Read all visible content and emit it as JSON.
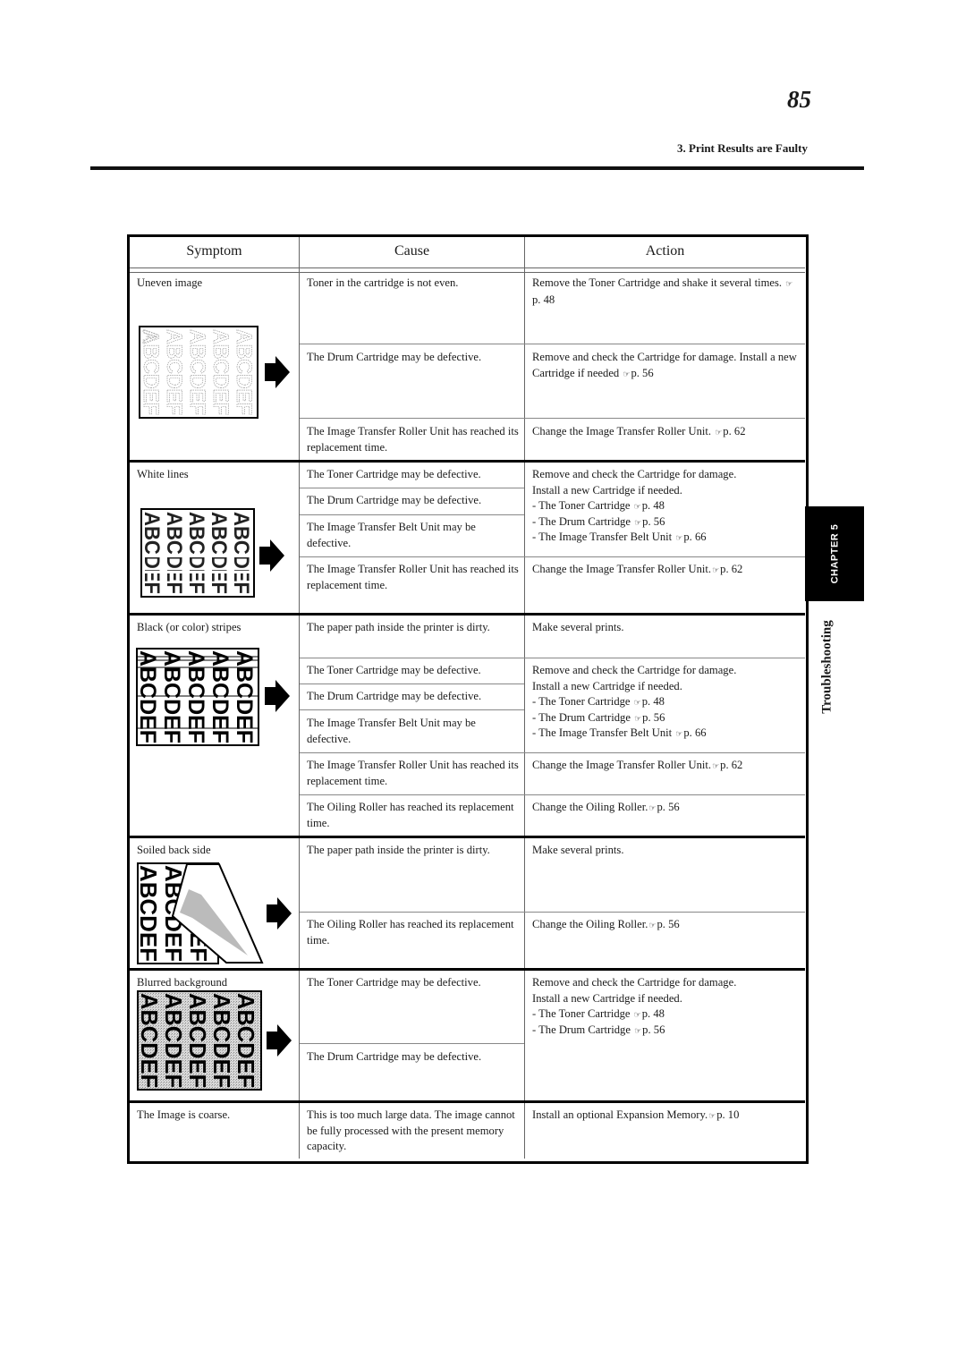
{
  "header": {
    "page_number": "85",
    "section_title": "3. Print Results are Faulty"
  },
  "side_tab": {
    "chapter_label": "CHAPTER 5",
    "chapter_title": "Troubleshooting"
  },
  "table": {
    "columns": [
      "Symptom",
      "Cause",
      "Action"
    ],
    "reference_icon": "pointing-hand-icon",
    "groups": [
      {
        "symptom": "Uneven image",
        "sample_image": "uneven-image-sample",
        "rows": [
          {
            "cause": "Toner in the cartridge is not even.",
            "action": "Remove the Toner Cartridge and shake it several times.",
            "action_ref": "p. 48"
          },
          {
            "cause": "The Drum Cartridge may be defective.",
            "action": "Remove and check the Cartridge for damage. Install a new Cartridge if needed",
            "action_ref": "p. 56"
          },
          {
            "cause": "The Image Transfer Roller Unit has reached its replacement time.",
            "action": "Change the Image Transfer Roller Unit.",
            "action_ref": "p. 62"
          }
        ]
      },
      {
        "symptom": "White lines",
        "sample_image": "white-lines-sample",
        "rows": [
          {
            "cause": "The Toner Cartridge may be defective."
          },
          {
            "cause": "The Drum Cartridge may be defective."
          },
          {
            "cause": "The Image Transfer Belt Unit may be defective."
          },
          {
            "cause": "The Image Transfer Roller Unit has reached its replacement time.",
            "action": "Change the Image Transfer Roller Unit.",
            "action_ref": "p. 62"
          }
        ],
        "shared_action": {
          "lines": [
            "Remove and check the Cartridge for damage.",
            "Install a new Cartridge if needed."
          ],
          "refs": [
            {
              "label": "- The Toner Cartridge",
              "ref": "p. 48"
            },
            {
              "label": "- The Drum Cartridge",
              "ref": "p. 56"
            },
            {
              "label": "- The Image Transfer Belt Unit",
              "ref": "p. 66"
            }
          ]
        }
      },
      {
        "symptom": "Black (or color) stripes",
        "sample_image": "black-stripes-sample",
        "rows": [
          {
            "cause": "The paper path inside the printer is dirty.",
            "action": "Make several prints."
          },
          {
            "cause": "The Toner Cartridge may be defective."
          },
          {
            "cause": "The Drum Cartridge may be defective."
          },
          {
            "cause": "The Image Transfer Belt Unit may be defective."
          },
          {
            "cause": "The Image Transfer Roller Unit has reached its replacement time.",
            "action": "Change the Image Transfer Roller Unit.",
            "action_ref": "p. 62"
          },
          {
            "cause": "The Oiling Roller has reached its replacement time.",
            "action": "Change the Oiling Roller.",
            "action_ref": "p. 56"
          }
        ],
        "shared_action": {
          "lines": [
            "Remove and check the Cartridge for damage.",
            "Install a new Cartridge if needed."
          ],
          "refs": [
            {
              "label": "- The Toner Cartridge",
              "ref": "p. 48"
            },
            {
              "label": "- The Drum Cartridge",
              "ref": "p. 56"
            },
            {
              "label": "- The Image Transfer Belt Unit",
              "ref": "p. 66"
            }
          ]
        }
      },
      {
        "symptom": "Soiled back side",
        "sample_image": "soiled-back-side-sample",
        "rows": [
          {
            "cause": "The paper path inside the printer is dirty.",
            "action": "Make several prints."
          },
          {
            "cause": "The Oiling Roller has reached its replacement time.",
            "action": "Change the Oiling Roller.",
            "action_ref": "p. 56"
          }
        ]
      },
      {
        "symptom": "Blurred background",
        "sample_image": "blurred-background-sample",
        "rows": [
          {
            "cause": "The Toner Cartridge may be defective."
          },
          {
            "cause": "The Drum Cartridge may be defective."
          }
        ],
        "shared_action": {
          "lines": [
            "Remove and check the Cartridge for damage.",
            "Install a new Cartridge if needed."
          ],
          "refs": [
            {
              "label": "- The Toner Cartridge",
              "ref": "p. 48"
            },
            {
              "label": "- The Drum Cartridge",
              "ref": "p. 56"
            }
          ]
        }
      },
      {
        "symptom": "The Image is coarse.",
        "rows": [
          {
            "cause": "This is too much large data. The image cannot be fully processed with the present memory capacity.",
            "action": "Install an optional Expansion Memory.",
            "action_ref": "p. 10"
          }
        ]
      }
    ]
  }
}
